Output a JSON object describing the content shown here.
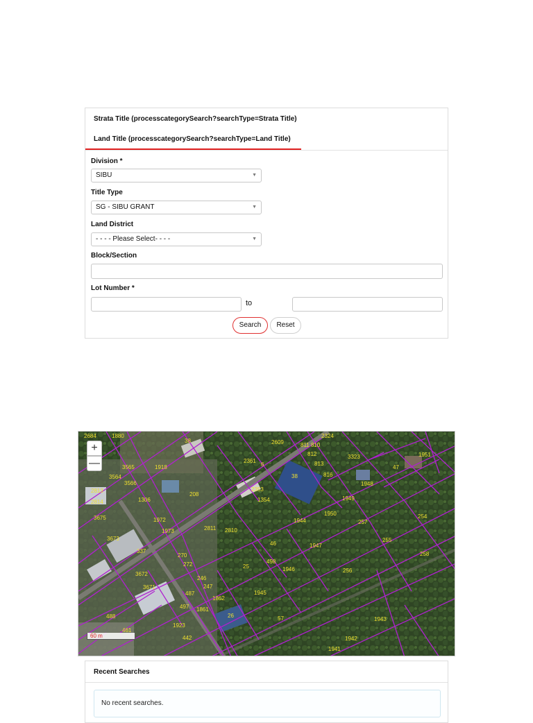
{
  "tabs": [
    {
      "label": "Strata Title (processcategorySearch?searchType=Strata Title)"
    },
    {
      "label": "Land Title (processcategorySearch?searchType=Land Title)"
    }
  ],
  "form": {
    "division_label": "Division *",
    "division_value": "SIBU",
    "title_type_label": "Title Type",
    "title_type_value": "SG - SIBU GRANT",
    "land_district_label": "Land District",
    "land_district_value": "- - - - Please Select- - - -",
    "block_label": "Block/Section",
    "block_value": "",
    "lot_label": "Lot Number *",
    "lot_from": "",
    "lot_to_label": "to",
    "lot_to": "",
    "search_label": "Search",
    "reset_label": "Reset"
  },
  "map": {
    "zoom_in": "+",
    "zoom_out": "—",
    "scale": "60 m",
    "lot_numbers": [
      "2684",
      "1880",
      "38",
      "2609",
      "811 810",
      "812",
      "813",
      "2324",
      "3323",
      "1951",
      "3565",
      "1918",
      "2361",
      "6",
      "38",
      "816",
      "47",
      "3564",
      "3566",
      "1948",
      "2813",
      "1306",
      "208",
      "2353",
      "1354",
      "1949",
      "2814",
      "1972",
      "1950",
      "1944",
      "3675",
      "1973",
      "2811",
      "2810",
      "257",
      "254",
      "3673",
      "46",
      "1947",
      "255",
      "337",
      "270",
      "272",
      "25",
      "498",
      "1946",
      "258",
      "3672",
      "246",
      "247",
      "256",
      "3671",
      "1862",
      "1945",
      "487",
      "497",
      "1861",
      "26",
      "57",
      "1943",
      "488",
      "1923",
      "1942",
      "461",
      "442",
      "1941"
    ]
  },
  "recent": {
    "title": "Recent Searches",
    "empty": "No recent searches."
  },
  "colors": {
    "accent": "#e02020",
    "parcel_lines": "#b020d0",
    "lot_label": "#f0e030"
  }
}
